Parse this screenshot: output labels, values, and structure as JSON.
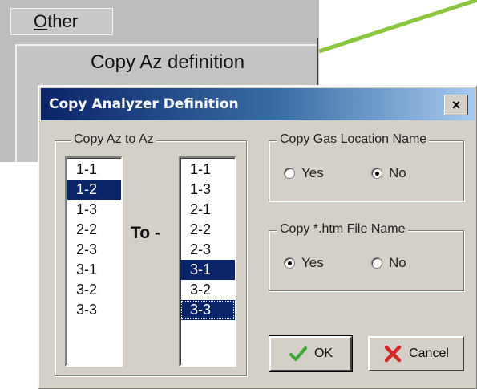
{
  "menu": {
    "tab_label": "Other",
    "item_label": "Copy Az definition"
  },
  "dialog": {
    "title": "Copy Analyzer Definition",
    "close_label": "×",
    "copy_group": {
      "legend": "Copy Az to Az",
      "to_label": "To -",
      "source_items": [
        "1-1",
        "1-2",
        "1-3",
        "2-2",
        "2-3",
        "3-1",
        "3-2",
        "3-3"
      ],
      "source_selected": "1-2",
      "target_items": [
        "1-1",
        "1-3",
        "2-1",
        "2-2",
        "2-3",
        "3-1",
        "3-2",
        "3-3"
      ],
      "target_selected": [
        "3-1",
        "3-3"
      ]
    },
    "gas_group": {
      "legend": "Copy Gas Location Name",
      "yes_label": "Yes",
      "no_label": "No",
      "selected": "No"
    },
    "htm_group": {
      "legend": "Copy *.htm File Name",
      "yes_label": "Yes",
      "no_label": "No",
      "selected": "Yes"
    },
    "ok_label": "OK",
    "cancel_label": "Cancel"
  },
  "colors": {
    "connector": "#8cc63f",
    "selection": "#0a246a",
    "dialog_face": "#d4d0c8",
    "ok_icon": "#3aa635",
    "cancel_icon": "#d62828"
  }
}
